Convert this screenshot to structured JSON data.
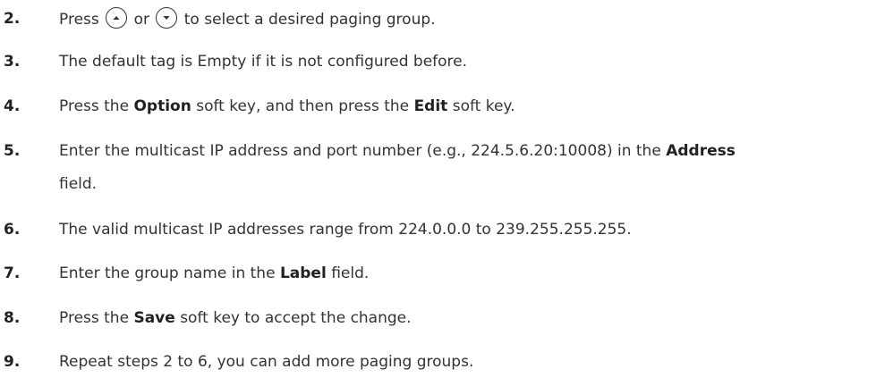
{
  "steps": [
    {
      "num": "2.",
      "pre": "Press",
      "mid": "or",
      "post": "to select a desired paging group."
    },
    {
      "num": "3.",
      "text": "The default tag is Empty if it is not configured before."
    },
    {
      "num": "4.",
      "pre": "Press the",
      "b1": "Option",
      "mid": "soft key, and then press the",
      "b2": "Edit",
      "post": "soft key."
    },
    {
      "num": "5.",
      "pre": "Enter the multicast IP address and port number (e.g., 224.5.6.20:10008) in the",
      "b1": "Address",
      "post": "field."
    },
    {
      "num": "6.",
      "text": "The valid multicast IP addresses range from 224.0.0.0 to 239.255.255.255."
    },
    {
      "num": "7.",
      "pre": "Enter the group name in the",
      "b1": "Label",
      "post": "field."
    },
    {
      "num": "8.",
      "pre": "Press the",
      "b1": "Save",
      "post": "soft key to accept the change."
    },
    {
      "num": "9.",
      "text": "Repeat steps 2 to 6, you can add more paging groups."
    }
  ],
  "icons": {
    "up": "up-navigation-key-icon",
    "down": "down-navigation-key-icon"
  }
}
